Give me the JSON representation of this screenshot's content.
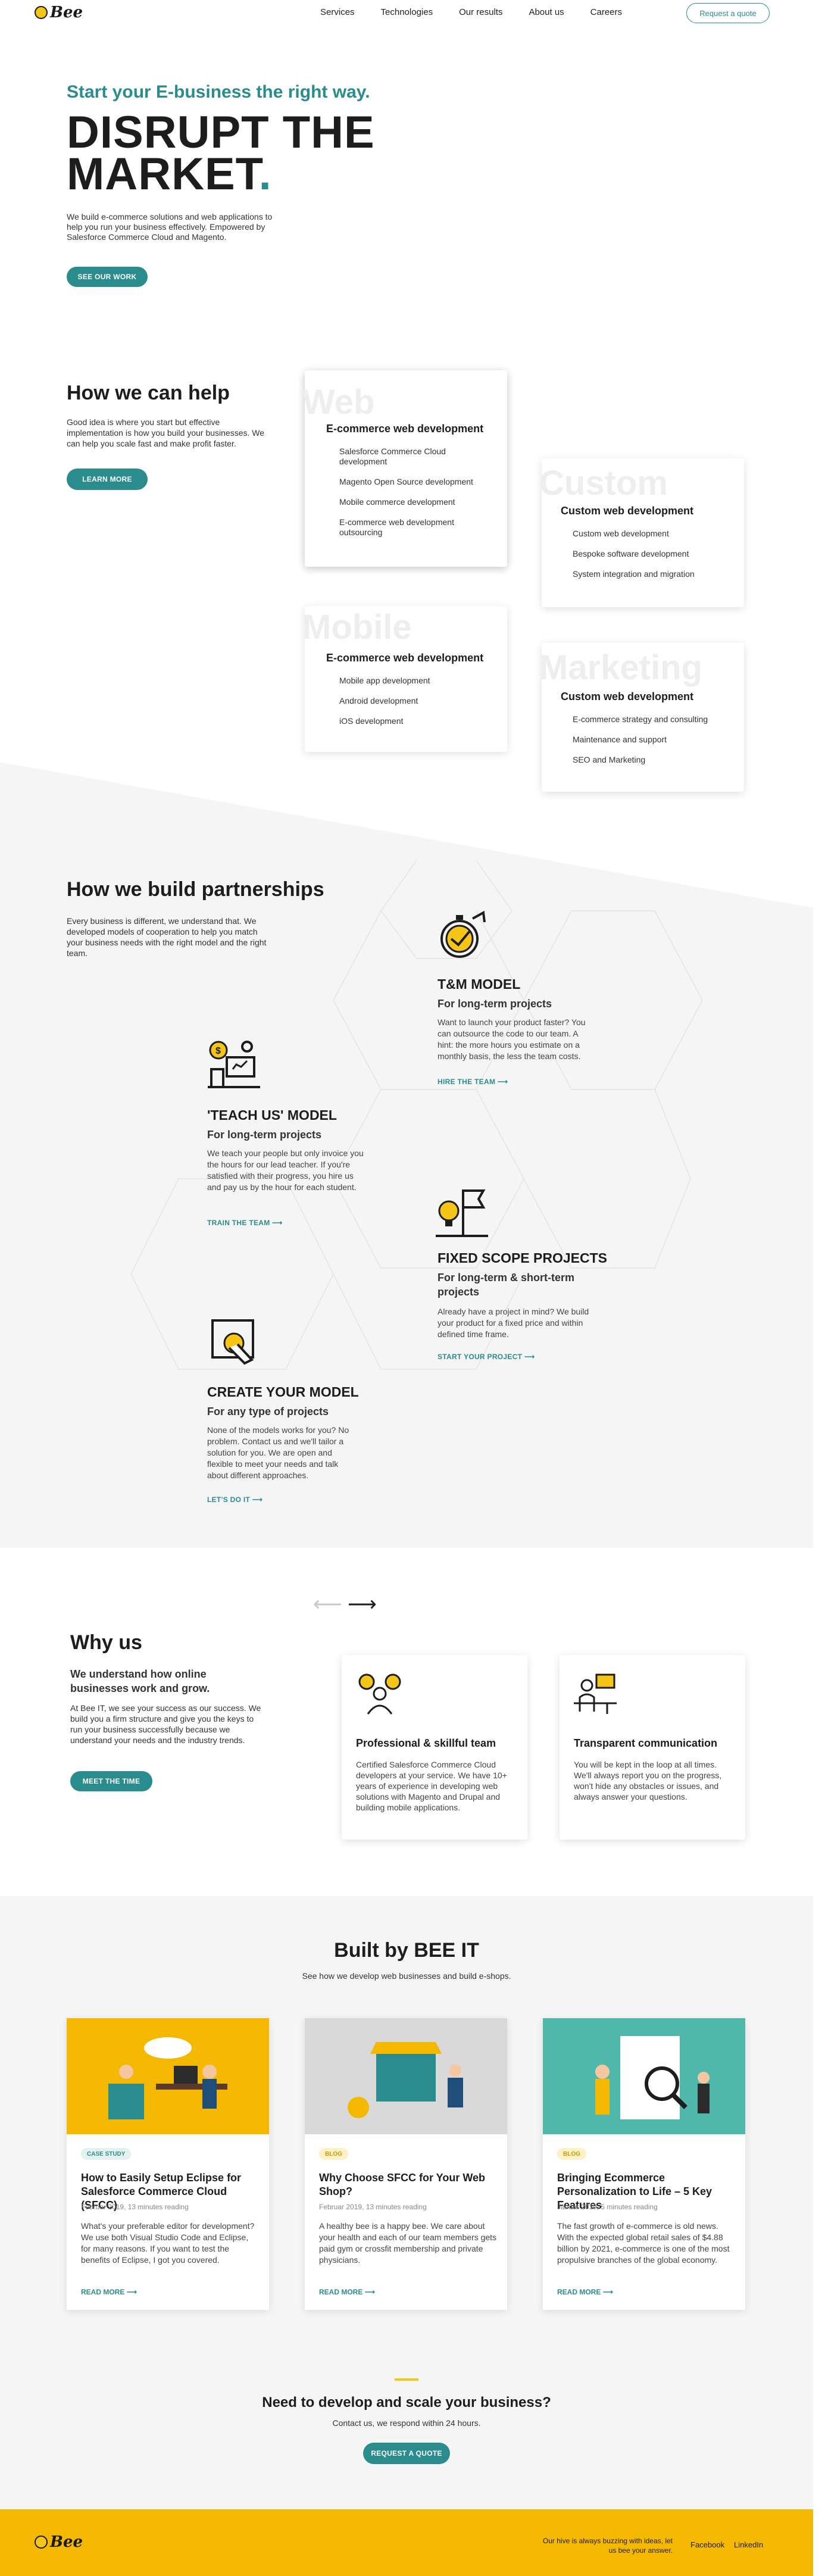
{
  "header": {
    "logo_text": "Bee",
    "nav": [
      "Services",
      "Technologies",
      "Our results",
      "About us",
      "Careers"
    ],
    "quote_button": "Request a quote"
  },
  "hero": {
    "subtitle": "Start your E-business the right way.",
    "title_line1": "DISRUPT THE",
    "title_line2": "MARKET",
    "title_dot": ".",
    "text": "We build e-commerce solutions and web applications to help you run your business effectively. Empowered by Salesforce Commerce Cloud and Magento.",
    "button": "SEE OUR WORK"
  },
  "help": {
    "title": "How we can help",
    "text": "Good idea is where you start but effective implementation is how you build your businesses. We can help you scale fast and make profit faster.",
    "button": "LEARN MORE",
    "cards": [
      {
        "bg": "Web",
        "title": "E-commerce web development",
        "items": [
          "Salesforce Commerce Cloud development",
          "Magento Open Source development",
          "Mobile commerce development",
          "E-commerce web development outsourcing"
        ]
      },
      {
        "bg": "Custom",
        "title": "Custom web development",
        "items": [
          "Custom web development",
          "Bespoke software development",
          "System integration and migration"
        ]
      },
      {
        "bg": "Mobile",
        "title": "E-commerce web development",
        "items": [
          "Mobile app development",
          "Android development",
          "iOS development"
        ]
      },
      {
        "bg": "Marketing",
        "title": "Custom web development",
        "items": [
          "E-commerce strategy and consulting",
          "Maintenance and support",
          "SEO and Marketing"
        ]
      }
    ]
  },
  "partnerships": {
    "title": "How we build partnerships",
    "text": "Every business is different, we understand that. We developed models of cooperation to help you match your business needs with the right model and the right team.",
    "models": [
      {
        "icon": "stopwatch-coin-icon",
        "title": "T&M MODEL",
        "subtitle": "For long-term projects",
        "text": "Want to launch your product faster? You can outsource the code to our team. A hint: the more hours you estimate on a monthly basis, the less the team costs.",
        "link": "HIRE THE TEAM"
      },
      {
        "icon": "teacher-board-icon",
        "title": "'TEACH US' MODEL",
        "subtitle": "For long-term projects",
        "text": "We teach your people but only invoice you the hours for our lead teacher. If you're satisfied with their progress, you hire us and pay us by the hour for each student.",
        "link": "TRAIN THE TEAM"
      },
      {
        "icon": "lightbulb-flag-icon",
        "title": "FIXED SCOPE PROJECTS",
        "subtitle": "For long-term & short-term projects",
        "text": "Already have a project in mind? We build your product for a fixed price and within defined time frame.",
        "link": "START YOUR PROJECT"
      },
      {
        "icon": "hand-drawing-icon",
        "title": "CREATE YOUR MODEL",
        "subtitle": "For any type of projects",
        "text": "None of the models works for you? No problem. Contact us and we'll tailor a solution for you. We are open and flexible to meet your needs and talk about different approaches.",
        "link": "LET'S DO IT"
      }
    ]
  },
  "why": {
    "title": "Why us",
    "subtitle": "We understand how online businesses work and grow.",
    "text": "At Bee IT, we see your success as our success. We build you a firm structure and give you the keys to run your business successfully because we understand your needs and the industry trends.",
    "button": "MEET THE TIME",
    "cards": [
      {
        "icon": "team-coins-icon",
        "title": "Professional & skillful team",
        "text": "Certified Salesforce Commerce Cloud developers at your service. We have 10+ years of experience in developing web solutions with Magento and Drupal and building mobile applications."
      },
      {
        "icon": "desk-worker-icon",
        "title": "Transparent communication",
        "text": "You will be kept in the loop at all times. We'll always report you on the progress, won't hide any obstacles or issues, and always answer your questions."
      }
    ]
  },
  "built": {
    "title": "Built by BEE IT",
    "subtitle": "See how we develop web businesses and build e-shops.",
    "posts": [
      {
        "tag": "CASE STUDY",
        "title": "How to Easily Setup Eclipse for Salesforce Commerce Cloud (SFCC)",
        "meta": "Februar 2019, 13 minutes reading",
        "text": "What's your preferable editor for development? We use both Visual Studio Code and Eclipse, for many reasons. If you want to test the benefits of Eclipse, I got you covered.",
        "link": "READ MORE"
      },
      {
        "tag": "BLOG",
        "title": "Why Choose SFCC for Your Web Shop?",
        "meta": "Februar 2019, 13 minutes reading",
        "text": "A healthy bee is a happy bee. We care about your health and each of our team members gets paid gym or crossfit membership and private physicians.",
        "link": "READ MORE"
      },
      {
        "tag": "BLOG",
        "title": "Bringing Ecommerce Personalization to Life – 5 Key Features",
        "meta": "Januar 2019, 5 minutes reading",
        "text": "The fast growth of e-commerce is old news. With the expected global retail sales of $4.88 billion by 2021, e-commerce is one of the most propulsive branches of the global economy.",
        "link": "READ MORE"
      }
    ]
  },
  "cta": {
    "title": "Need to develop and scale your business?",
    "subtitle": "Contact us, we respond within 24 hours.",
    "button": "REQUEST A QUOTE"
  },
  "footer": {
    "logo_text": "Bee",
    "tagline": "Our hive is always buzzing with ideas, let us bee your answer.",
    "links": [
      "Facebook",
      "LinkedIn"
    ]
  },
  "colors": {
    "accent": "#2a8c8c",
    "brand_yellow": "#f5b800",
    "dark": "#1d1d1d"
  }
}
